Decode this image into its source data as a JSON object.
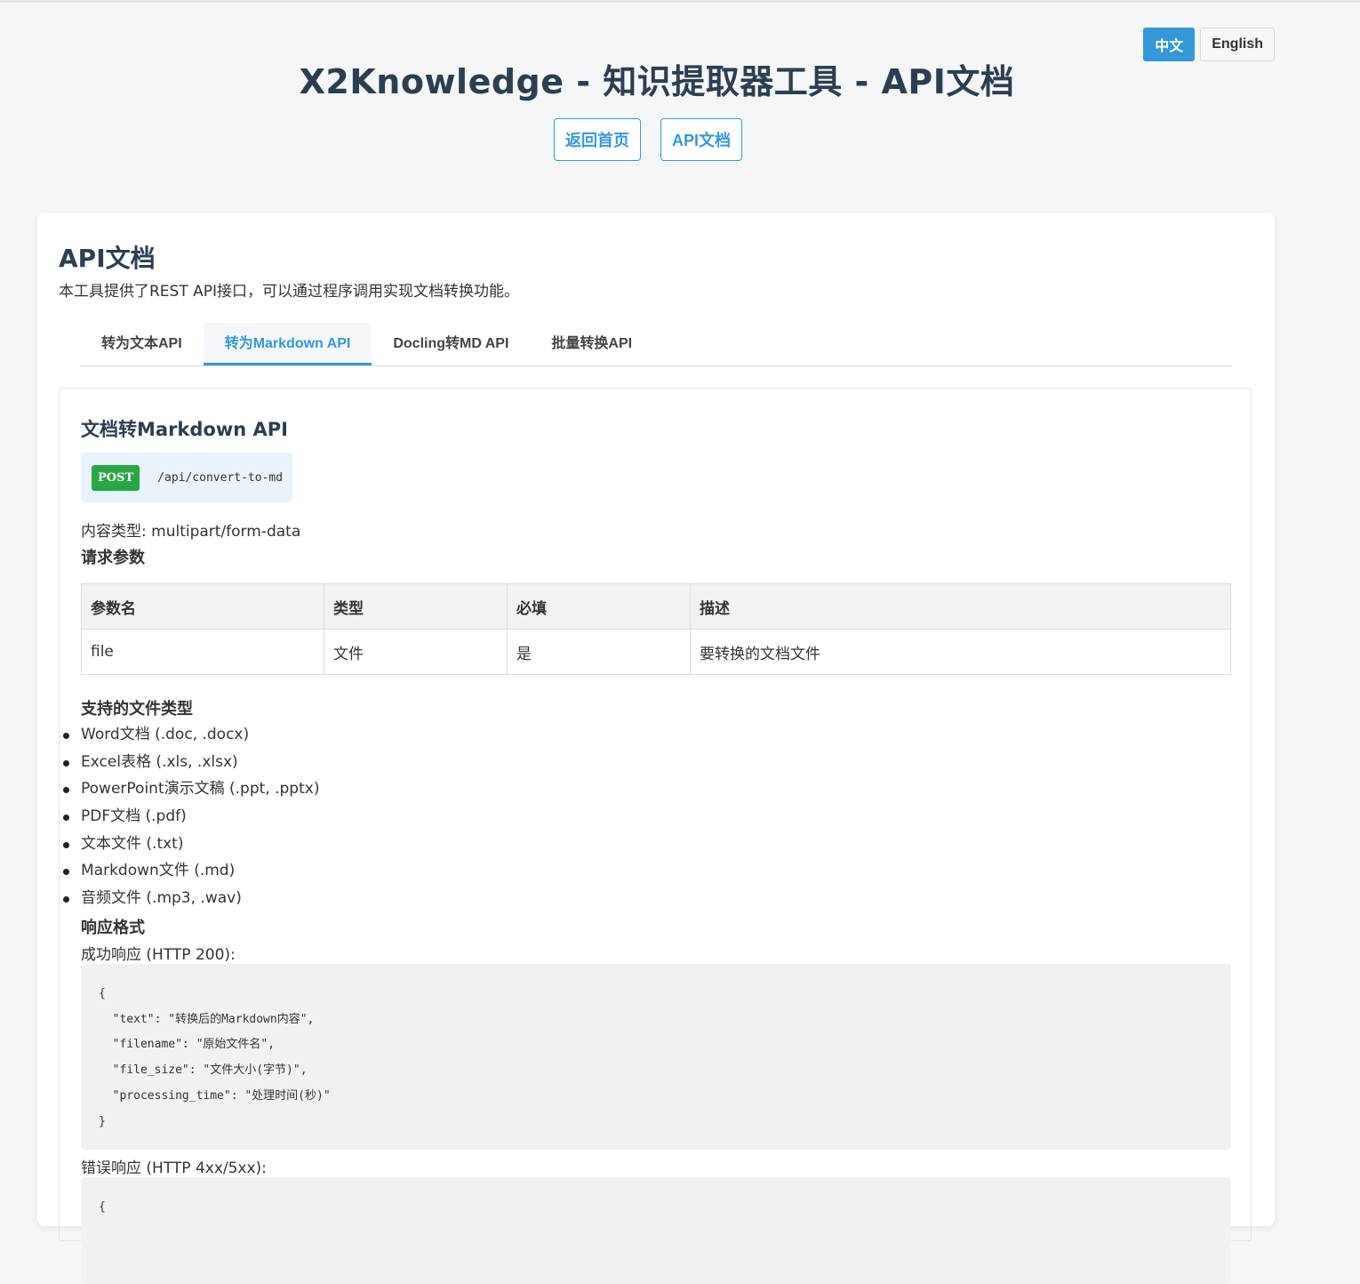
{
  "lang": {
    "zh": "中文",
    "en": "English"
  },
  "site_title": "X2Knowledge - 知识提取器工具 - API文档",
  "nav": {
    "home": "返回首页",
    "api_docs": "API文档"
  },
  "card": {
    "title": "API文档",
    "description": "本工具提供了REST API接口，可以通过程序调用实现文档转换功能。"
  },
  "tabs": [
    {
      "label": "转为文本API",
      "active": false
    },
    {
      "label": "转为Markdown API",
      "active": true
    },
    {
      "label": "Docling转MD API",
      "active": false
    },
    {
      "label": "批量转换API",
      "active": false
    }
  ],
  "panel": {
    "title": "文档转Markdown API",
    "method": "POST",
    "path": "/api/convert-to-md",
    "content_type": "内容类型: multipart/form-data",
    "params_title": "请求参数",
    "params_headers": [
      "参数名",
      "类型",
      "必填",
      "描述"
    ],
    "params_rows": [
      [
        "file",
        "文件",
        "是",
        "要转换的文档文件"
      ]
    ],
    "file_types_title": "支持的文件类型",
    "file_types": [
      "Word文档 (.doc, .docx)",
      "Excel表格 (.xls, .xlsx)",
      "PowerPoint演示文稿 (.ppt, .pptx)",
      "PDF文档 (.pdf)",
      "文本文件 (.txt)",
      "Markdown文件 (.md)",
      "音频文件 (.mp3, .wav)"
    ],
    "response_title": "响应格式",
    "success_label": "成功响应 (HTTP 200):",
    "success_code": "{\n  \"text\": \"转换后的Markdown内容\",\n  \"filename\": \"原始文件名\",\n  \"file_size\": \"文件大小(字节)\",\n  \"processing_time\": \"处理时间(秒)\"\n}",
    "error_label": "错误响应 (HTTP 4xx/5xx):",
    "error_code": "{"
  },
  "colors": {
    "accent": "#3498db",
    "method_post": "#28a745",
    "title": "#2c3e50"
  }
}
